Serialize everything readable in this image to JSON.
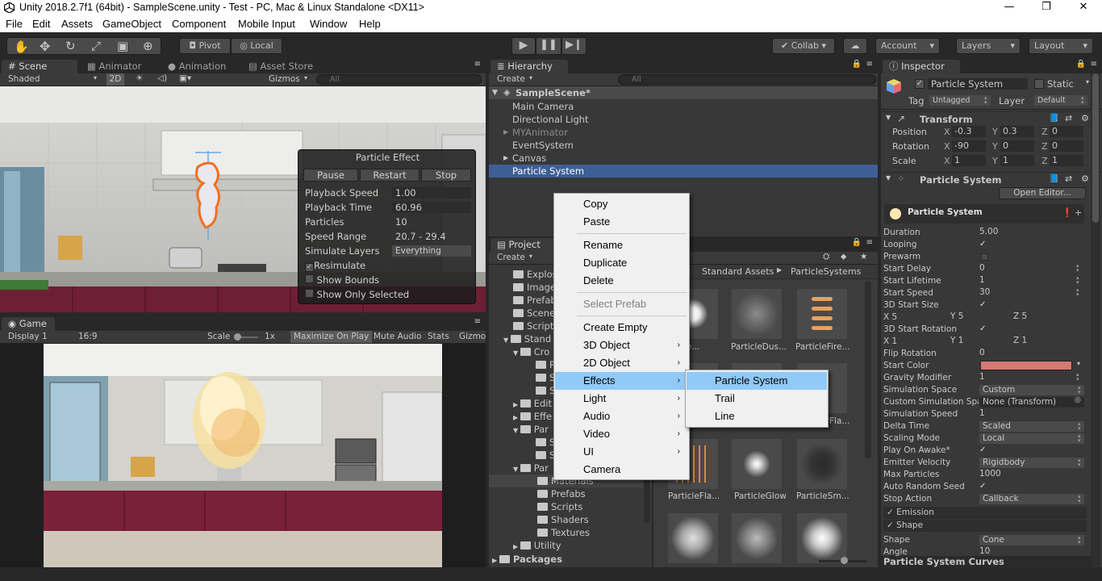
{
  "window": {
    "title": "Unity 2018.2.7f1 (64bit) - SampleScene.unity - Test - PC, Mac & Linux Standalone <DX11>",
    "minimize": "—",
    "restore": "❐",
    "close": "✕"
  },
  "menu": [
    "File",
    "Edit",
    "Assets",
    "GameObject",
    "Component",
    "Mobile Input",
    "Window",
    "Help"
  ],
  "toolbar": {
    "pivot": "Pivot",
    "local": "Local",
    "collab": "Collab",
    "account": "Account",
    "layers": "Layers",
    "layout": "Layout"
  },
  "scene": {
    "tabs": [
      "Scene",
      "Animator",
      "Animation",
      "Asset Store"
    ],
    "shading": "Shaded",
    "mode2d": "2D",
    "gizmos": "Gizmos",
    "search_placeholder": "All"
  },
  "particle_effect": {
    "title": "Particle Effect",
    "pause": "Pause",
    "restart": "Restart",
    "stop": "Stop",
    "rows": [
      {
        "label": "Playback Speed",
        "value": "1.00"
      },
      {
        "label": "Playback Time",
        "value": "60.96"
      },
      {
        "label": "Particles",
        "value": "10"
      },
      {
        "label": "Speed Range",
        "value": "20.7 - 29.4"
      },
      {
        "label": "Simulate Layers",
        "value": "Everything"
      }
    ],
    "resimulate": "Resimulate",
    "show_bounds": "Show Bounds",
    "show_only_selected": "Show Only Selected"
  },
  "game": {
    "tab": "Game",
    "display": "Display 1",
    "aspect": "16:9",
    "scale_label": "Scale",
    "scale_value": "1x",
    "maximize": "Maximize On Play",
    "mute": "Mute Audio",
    "stats": "Stats",
    "gizmos": "Gizmo"
  },
  "hierarchy": {
    "tab": "Hierarchy",
    "create": "Create",
    "search_placeholder": "All",
    "scene": "SampleScene*",
    "items": [
      "Main Camera",
      "Directional Light",
      "MYAnimator",
      "EventSystem",
      "Canvas",
      "Particle System"
    ]
  },
  "project": {
    "tab": "Project",
    "create": "Create",
    "breadcrumb": [
      "Standard Assets",
      "ParticleSystems"
    ],
    "tree": [
      "Explos",
      "Image",
      "Prefab",
      "Scene",
      "Script",
      "Stand",
      "Cro",
      "P",
      "S",
      "S",
      "Edit",
      "Effe",
      "Par",
      "S",
      "S",
      "Par",
      "Materials",
      "Prefabs",
      "Scripts",
      "Shaders",
      "Textures",
      "Utility",
      "Packages"
    ],
    "tiles": [
      "eAfte...",
      "ParticleDus...",
      "ParticleFire...",
      "",
      "",
      "Fla...",
      "ParticleFla...",
      "ParticleGlow",
      "ParticleSm..."
    ]
  },
  "context_menu": {
    "items": [
      "Copy",
      "Paste",
      "Rename",
      "Duplicate",
      "Delete",
      "Select Prefab",
      "Create Empty",
      "3D Object",
      "2D Object",
      "Effects",
      "Light",
      "Audio",
      "Video",
      "UI",
      "Camera"
    ],
    "submenu": [
      "Particle System",
      "Trail",
      "Line"
    ]
  },
  "inspector": {
    "tab": "Inspector",
    "object_name": "Particle System",
    "static": "Static",
    "tag_label": "Tag",
    "tag": "Untagged",
    "layer_label": "Layer",
    "layer": "Default",
    "transform": {
      "title": "Transform",
      "position": {
        "label": "Position",
        "x": "-0.3",
        "y": "0.3",
        "z": "0"
      },
      "rotation": {
        "label": "Rotation",
        "x": "-90",
        "y": "0",
        "z": "0"
      },
      "scale": {
        "label": "Scale",
        "x": "1",
        "y": "1",
        "z": "1"
      }
    },
    "ps_component": "Particle System",
    "open_editor": "Open Editor...",
    "ps_module": "Particle System",
    "props": [
      {
        "label": "Duration",
        "value": "5.00"
      },
      {
        "label": "Looping",
        "value": "✓"
      },
      {
        "label": "Prewarm",
        "value": ""
      },
      {
        "label": "Start Delay",
        "value": "0"
      },
      {
        "label": "Start Lifetime",
        "value": "1"
      },
      {
        "label": "Start Speed",
        "value": "30"
      },
      {
        "label": "3D Start Size",
        "value": "✓"
      },
      {
        "label": "X 5",
        "value": ""
      },
      {
        "label": "3D Start Rotation",
        "value": "✓"
      },
      {
        "label": "X 1",
        "value": ""
      },
      {
        "label": "Flip Rotation",
        "value": "0"
      },
      {
        "label": "Start Color",
        "value": ""
      },
      {
        "label": "Gravity Modifier",
        "value": "1"
      },
      {
        "label": "Simulation Space",
        "value": "Custom"
      },
      {
        "label": "Custom Simulation Spa",
        "value": "None (Transform)"
      },
      {
        "label": "Simulation Speed",
        "value": "1"
      },
      {
        "label": "Delta Time",
        "value": "Scaled"
      },
      {
        "label": "Scaling Mode",
        "value": "Local"
      },
      {
        "label": "Play On Awake*",
        "value": "✓"
      },
      {
        "label": "Emitter Velocity",
        "value": "Rigidbody"
      },
      {
        "label": "Max Particles",
        "value": "1000"
      },
      {
        "label": "Auto Random Seed",
        "value": "✓"
      },
      {
        "label": "Stop Action",
        "value": "Callback"
      }
    ],
    "size_y": "Y 5",
    "size_z": "Z 5",
    "rot_y": "Y 1",
    "rot_z": "Z 1",
    "emission": "Emission",
    "shape": "Shape",
    "shape_label": "Shape",
    "shape_value": "Cone",
    "angle_label": "Angle",
    "angle_value": "10",
    "curves": "Particle System Curves"
  }
}
